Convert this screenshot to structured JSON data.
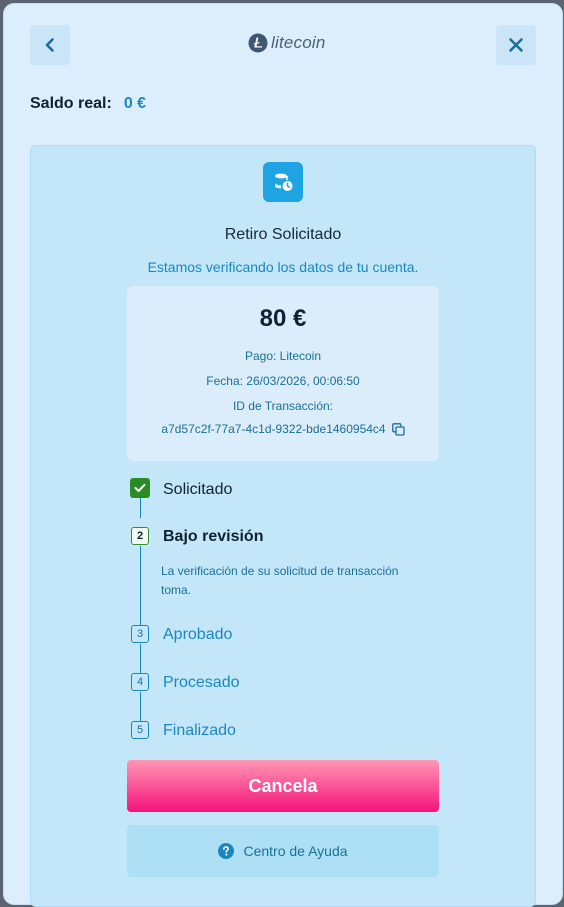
{
  "header": {
    "back_icon": "chevron-left-icon",
    "close_icon": "close-icon",
    "brand": "litecoin"
  },
  "balance": {
    "label": "Saldo real:",
    "value": "0 €"
  },
  "status": {
    "icon": "coins-clock-icon",
    "title": "Retiro Solicitado",
    "subtitle": "Estamos verificando los datos de tu cuenta."
  },
  "transaction": {
    "amount": "80 €",
    "payment": "Pago: Litecoin",
    "date": "Fecha: 26/03/2026, 00:06:50",
    "id_label": "ID de Transacción:",
    "id_value": "a7d57c2f-77a7-4c1d-9322-bde1460954c4"
  },
  "steps": [
    {
      "number": "1",
      "label": "Solicitado",
      "state": "done"
    },
    {
      "number": "2",
      "label": "Bajo revisión",
      "state": "current",
      "note": "La verificación de su solicitud de transacción toma."
    },
    {
      "number": "3",
      "label": "Aprobado",
      "state": "pending"
    },
    {
      "number": "4",
      "label": "Procesado",
      "state": "pending"
    },
    {
      "number": "5",
      "label": "Finalizado",
      "state": "pending"
    }
  ],
  "actions": {
    "cancel_label": "Cancela",
    "help_label": "Centro de Ayuda"
  },
  "colors": {
    "accent": "#1b87c2",
    "done_green": "#2a8a24",
    "cancel_pink": "#f5127a"
  }
}
